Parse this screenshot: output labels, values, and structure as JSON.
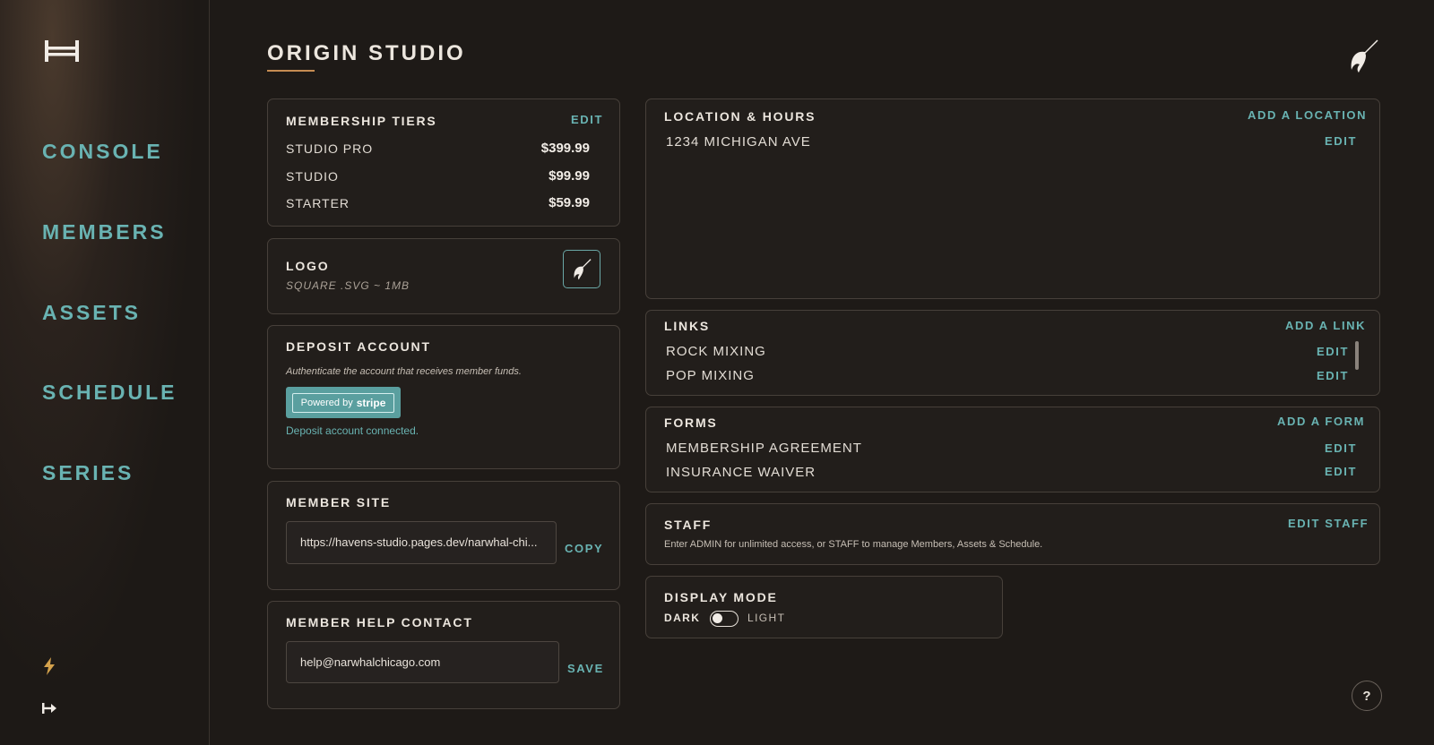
{
  "sidebar": {
    "nav": [
      {
        "label": "CONSOLE"
      },
      {
        "label": "MEMBERS"
      },
      {
        "label": "ASSETS"
      },
      {
        "label": "SCHEDULE"
      },
      {
        "label": "SERIES"
      }
    ],
    "bottom_icons": [
      "lightning-icon",
      "logout-arrow-icon"
    ]
  },
  "header": {
    "title": "ORIGIN STUDIO",
    "logo_icon": "narwhal-icon"
  },
  "membership": {
    "title": "MEMBERSHIP TIERS",
    "edit_label": "EDIT",
    "tiers": [
      {
        "name": "STUDIO PRO",
        "price": "$399.99"
      },
      {
        "name": "STUDIO",
        "price": "$99.99"
      },
      {
        "name": "STARTER",
        "price": "$59.99"
      }
    ]
  },
  "logo": {
    "title": "LOGO",
    "subtitle": "SQUARE .SVG ~ 1MB"
  },
  "deposit": {
    "title": "DEPOSIT ACCOUNT",
    "description": "Authenticate the account that receives member funds.",
    "button_prefix": "Powered by",
    "button_brand": "stripe",
    "status": "Deposit account connected."
  },
  "member_site": {
    "title": "MEMBER SITE",
    "url": "https://havens-studio.pages.dev/narwhal-chi...",
    "copy_label": "COPY"
  },
  "help_contact": {
    "title": "MEMBER HELP CONTACT",
    "email": "help@narwhalchicago.com",
    "save_label": "SAVE"
  },
  "location": {
    "title": "LOCATION & HOURS",
    "add_label": "ADD A LOCATION",
    "items": [
      {
        "name": "1234 MICHIGAN AVE",
        "edit": "EDIT"
      }
    ]
  },
  "links": {
    "title": "LINKS",
    "add_label": "ADD A LINK",
    "items": [
      {
        "name": "ROCK MIXING",
        "edit": "EDIT"
      },
      {
        "name": "POP MIXING",
        "edit": "EDIT"
      }
    ]
  },
  "forms": {
    "title": "FORMS",
    "add_label": "ADD A FORM",
    "items": [
      {
        "name": "MEMBERSHIP AGREEMENT",
        "edit": "EDIT"
      },
      {
        "name": "INSURANCE WAIVER",
        "edit": "EDIT"
      }
    ]
  },
  "staff": {
    "title": "STAFF",
    "edit_label": "EDIT STAFF",
    "description": "Enter ADMIN for unlimited access, or STAFF to manage Members, Assets & Schedule."
  },
  "display_mode": {
    "title": "DISPLAY MODE",
    "dark_label": "DARK",
    "light_label": "LIGHT",
    "mode": "dark"
  },
  "help": {
    "label": "?"
  },
  "colors": {
    "accent": "#69b3b2",
    "underline": "#c58c52",
    "lightning": "#d4a24c",
    "background": "#1e1a17"
  }
}
